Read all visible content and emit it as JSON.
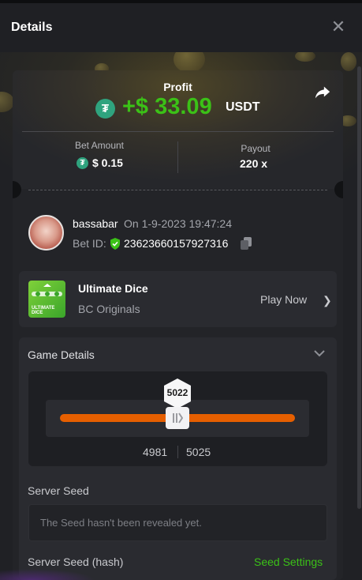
{
  "header": {
    "title": "Details",
    "close_icon": "close-icon"
  },
  "summary": {
    "profit_label": "Profit",
    "profit_value": "+$ 33.09",
    "profit_currency": "USDT",
    "currency_icon": "tether-icon",
    "share_icon": "share-icon",
    "bet_amount_label": "Bet Amount",
    "bet_amount_value": "$ 0.15",
    "payout_label": "Payout",
    "payout_value": "220 x"
  },
  "bet": {
    "username": "bassabar",
    "date": "On 1-9-2023 19:47:24",
    "bet_id_label": "Bet ID:",
    "bet_id_value": "23623660157927316",
    "verified_icon": "shield-check-icon",
    "copy_icon": "copy-icon"
  },
  "game": {
    "thumb_label_line1": "ULTIMATE",
    "thumb_label_line2": "DICE",
    "name": "Ultimate Dice",
    "provider": "BC Originals",
    "play_label": "Play Now"
  },
  "details": {
    "title": "Game Details",
    "result": "5022",
    "range_low": "4981",
    "range_high": "5025",
    "server_seed_label": "Server Seed",
    "server_seed_placeholder": "The Seed hasn't been revealed yet.",
    "server_seed_hash_label": "Server Seed (hash)",
    "seed_settings_label": "Seed Settings"
  },
  "colors": {
    "accent_green": "#3bc117",
    "slider_orange": "#e65f00",
    "tether_green": "#2fa37e"
  }
}
